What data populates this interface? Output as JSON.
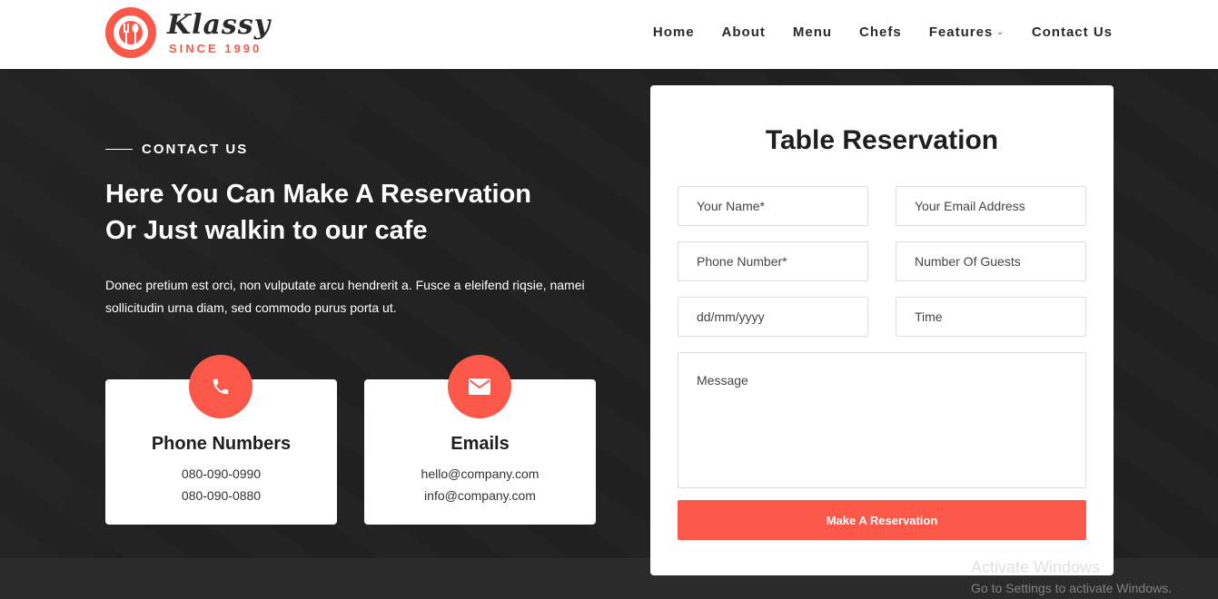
{
  "brand": {
    "name": "Klassy",
    "since": "SINCE 1990",
    "accent_color": "#fb5849",
    "logo_icon": "plate-fork-spoon-icon"
  },
  "nav": {
    "items": [
      {
        "label": "Home"
      },
      {
        "label": "About"
      },
      {
        "label": "Menu"
      },
      {
        "label": "Chefs"
      },
      {
        "label": "Features",
        "has_dropdown": true
      },
      {
        "label": "Contact Us"
      }
    ]
  },
  "contact": {
    "tag": "CONTACT US",
    "title_line1": "Here You Can Make A Reservation",
    "title_line2": "Or Just walkin to our cafe",
    "text": "Donec pretium est orci, non vulputate arcu hendrerit a. Fusce a eleifend riqsie, namei sollicitudin urna diam, sed commodo purus porta ut.",
    "cards": [
      {
        "icon": "phone-icon",
        "title": "Phone Numbers",
        "line1": "080-090-0990",
        "line2": "080-090-0880"
      },
      {
        "icon": "envelope-icon",
        "title": "Emails",
        "line1": "hello@company.com",
        "line2": "info@company.com"
      }
    ]
  },
  "reservation": {
    "title": "Table Reservation",
    "fields": {
      "name": "Your Name*",
      "email": "Your Email Address",
      "phone": "Phone Number*",
      "guests": "Number Of Guests",
      "date": "dd/mm/yyyy",
      "time": "Time",
      "message": "Message"
    },
    "submit_label": "Make A Reservation"
  },
  "watermark": {
    "line1": "Activate Windows",
    "line2": "Go to Settings to activate Windows."
  }
}
